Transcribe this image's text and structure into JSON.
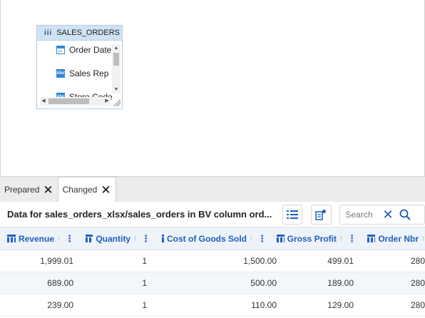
{
  "table_widget": {
    "title": "SALES_ORDERS",
    "icon_text": "iii",
    "fields": [
      {
        "label": "Order Date",
        "icon": "calendar-icon"
      },
      {
        "label": "Sales Rep",
        "icon": "text-field-icon"
      },
      {
        "label": "Store Code",
        "icon": "text-field-icon"
      }
    ]
  },
  "tabs": [
    {
      "label": "Prepared",
      "active": false
    },
    {
      "label": "Changed",
      "active": true
    }
  ],
  "toolbar": {
    "title": "Data for sales_orders_xlsx/sales_orders in BV column ord...",
    "search_placeholder": "Search"
  },
  "grid": {
    "columns": [
      "Revenue",
      "Quantity",
      "Cost of Goods Sold",
      "Gross Profit",
      "Order Nbr"
    ],
    "rows": [
      [
        "1,999.01",
        "1",
        "1,500.00",
        "499.01",
        "280"
      ],
      [
        "689.00",
        "1",
        "500.00",
        "189.00",
        "280"
      ],
      [
        "239.00",
        "1",
        "110.00",
        "129.00",
        "280"
      ]
    ]
  },
  "colors": {
    "accent": "#1f5fbf",
    "header_bg": "#eef3f8",
    "widget_header_bg": "#cfe3f5"
  }
}
